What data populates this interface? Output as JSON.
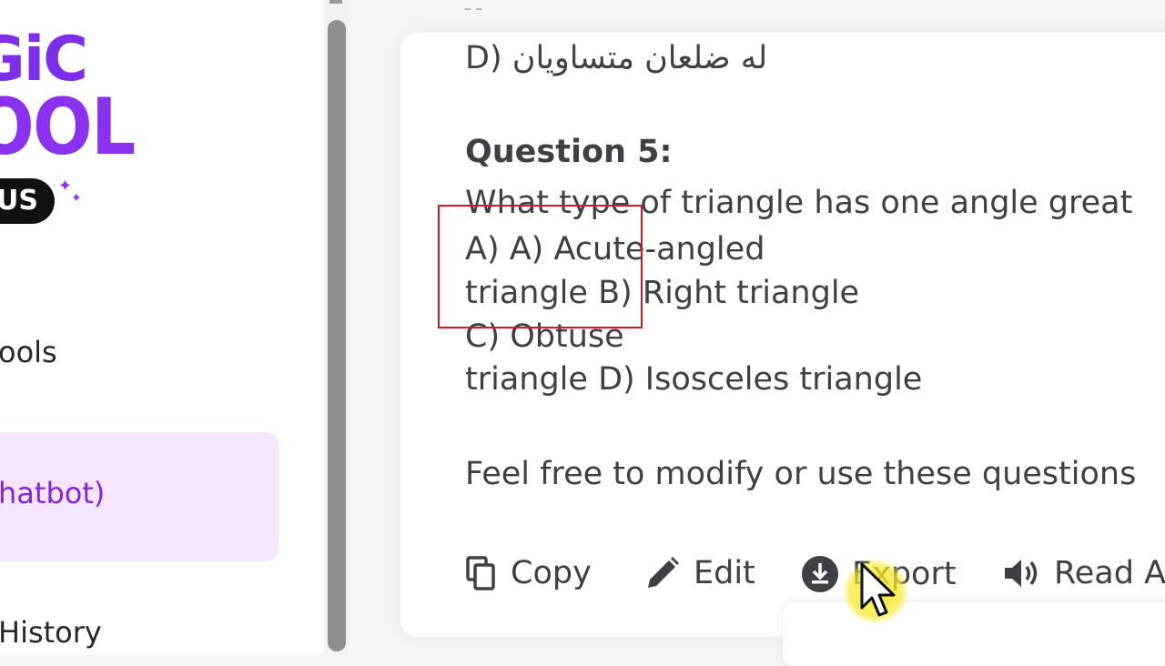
{
  "sidebar": {
    "logo": {
      "line1": "GiC",
      "line2": "OOL",
      "badge": "US"
    },
    "items": [
      {
        "label": "ools"
      },
      {
        "label": "hatbot)"
      },
      {
        "label": "History"
      }
    ]
  },
  "main": {
    "partial_top_text": "ـ ـ",
    "option_d_prev": "D) له ضلعان متساويان",
    "question_title": "Question 5:",
    "question_text": "What type of triangle has one angle great",
    "options_line1": "A) A) Acute-angled",
    "options_line2": "triangle B) Right triangle",
    "options_line3": "C) Obtuse",
    "options_line4": "triangle D) Isosceles triangle",
    "footer_note": "Feel free to modify or use these questions"
  },
  "actions": {
    "copy": "Copy",
    "edit": "Edit",
    "export": "Export",
    "read": "Read A"
  },
  "colors": {
    "accent": "#8226e0",
    "highlight_box": "#d11a2a",
    "cursor_glow": "#f5e828"
  }
}
